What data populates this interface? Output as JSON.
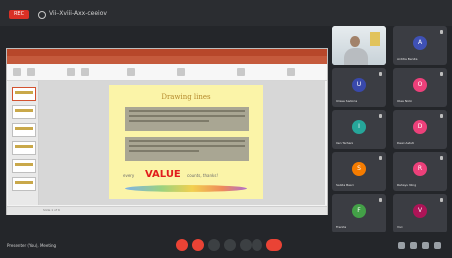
{
  "meeting": {
    "title": "Vii–Xviii-Axx-ceeiov",
    "rec_label": "REC"
  },
  "slide": {
    "title": "Drawing lines",
    "value_prefix": "every",
    "value_word": "VALUE",
    "value_suffix": "counts, thanks!"
  },
  "status": {
    "text": "Slide 1 of 6"
  },
  "participants": [
    {
      "name": "",
      "initial": "",
      "color": "#5c6bc0"
    },
    {
      "name": "Arditia Benita",
      "initial": "A",
      "color": "#3f51b5"
    },
    {
      "name": "Ulisse Sadoria",
      "initial": "U",
      "color": "#3949ab"
    },
    {
      "name": "Olea Nicki",
      "initial": "O",
      "color": "#ec407a"
    },
    {
      "name": "Ilen Tarhani",
      "initial": "I",
      "color": "#26a69a"
    },
    {
      "name": "Dewi Astuti",
      "initial": "D",
      "color": "#ec407a"
    },
    {
      "name": "Salida Basri",
      "initial": "S",
      "color": "#f57c00"
    },
    {
      "name": "Rahayu Ning",
      "initial": "R",
      "color": "#ec407a"
    },
    {
      "name": "Frenita",
      "initial": "F",
      "color": "#43a047"
    },
    {
      "name": "Vivi",
      "initial": "V",
      "color": "#ad1457"
    }
  ],
  "self": {
    "name": "Presenter (You), Meeting"
  },
  "colors": {
    "rec": "#d93025",
    "end_call": "#ea4335",
    "accent": "#d35230"
  }
}
